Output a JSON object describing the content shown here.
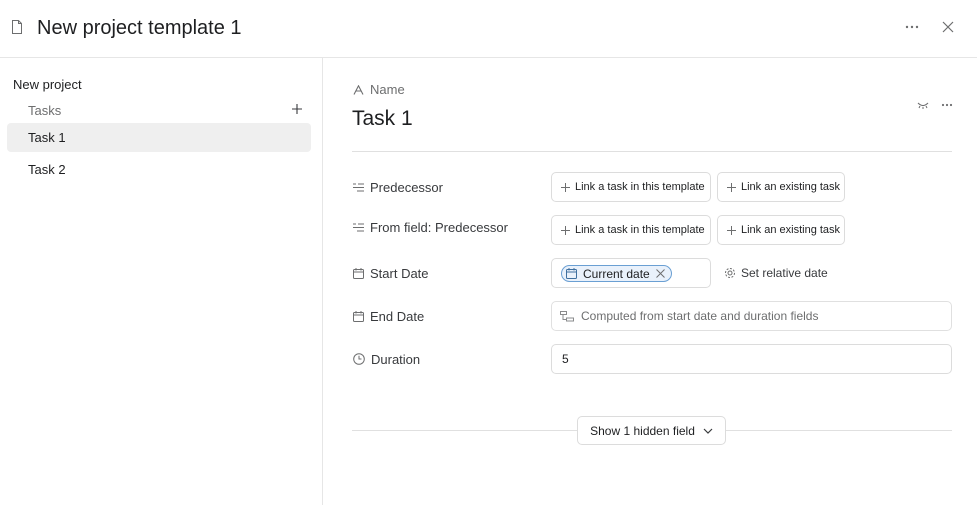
{
  "header": {
    "title": "New project template 1",
    "icons": {
      "doc": "document-icon",
      "more": "more-horizontal-icon",
      "close": "close-icon"
    }
  },
  "sidebar": {
    "project_title": "New project",
    "section_label": "Tasks",
    "tasks": [
      {
        "label": "Task 1",
        "selected": true
      },
      {
        "label": "Task 2",
        "selected": false
      }
    ]
  },
  "main": {
    "name_label": "Name",
    "task_title": "Task 1",
    "fields": {
      "predecessor": {
        "label": "Predecessor",
        "link_template": "Link a task in this template",
        "link_existing": "Link an existing task"
      },
      "from_field_predecessor": {
        "label": "From field: Predecessor",
        "link_template": "Link a task in this template",
        "link_existing": "Link an existing task"
      },
      "start_date": {
        "label": "Start Date",
        "chip": "Current date",
        "relative": "Set relative date"
      },
      "end_date": {
        "label": "End Date",
        "computed": "Computed from start date and duration fields"
      },
      "duration": {
        "label": "Duration",
        "value": "5"
      }
    },
    "show_hidden": "Show 1 hidden field"
  },
  "colors": {
    "chip_border": "#6a9fd3",
    "chip_bg": "#e9f1fb",
    "selected_bg": "#efefef"
  }
}
